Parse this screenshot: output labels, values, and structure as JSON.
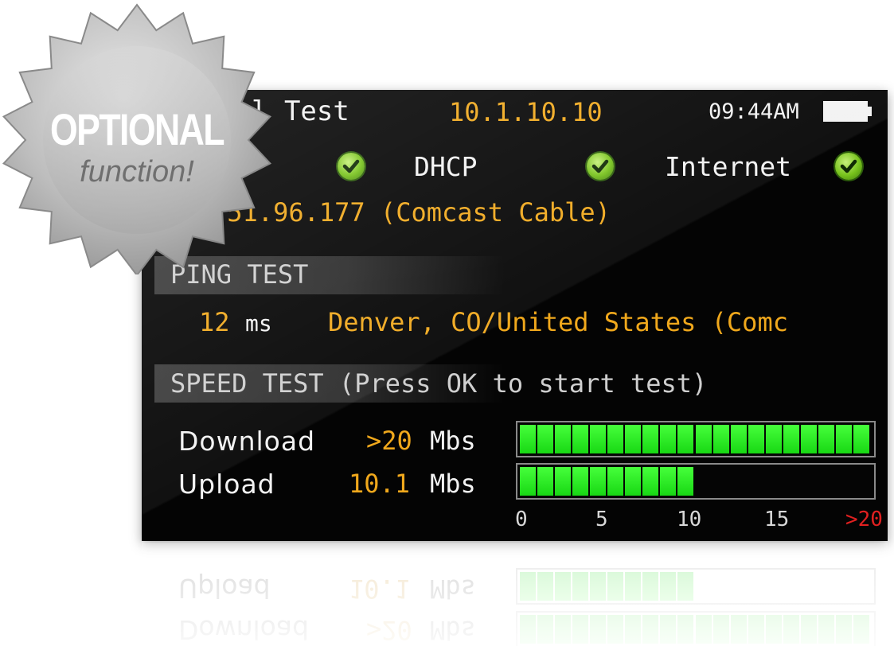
{
  "header": {
    "title": "l Test",
    "ip": "10.1.10.10",
    "time": "09:44AM",
    "battery_icon": "battery-full-icon"
  },
  "status": {
    "dhcp_label": "DHCP",
    "internet_label": "Internet",
    "check_icon": "check-circle-icon"
  },
  "public_ip_line": ".51.96.177 (Comcast Cable)",
  "ping": {
    "section_title": "PING TEST",
    "value": "12",
    "unit": "ms",
    "server": "Denver, CO/United States (Comc"
  },
  "speed": {
    "section_title": "SPEED TEST (Press OK to start test)",
    "download": {
      "label": "Download",
      "value": ">20",
      "unit": "Mbs",
      "level_fraction": 1.0
    },
    "upload": {
      "label": "Upload",
      "value": "10.1",
      "unit": "Mbs",
      "level_fraction": 0.5
    },
    "scale": [
      "0",
      "5",
      "10",
      "15",
      ">20"
    ]
  },
  "badge": {
    "line1": "OPTIONAL",
    "line2": "function!"
  },
  "colors": {
    "amber": "#f0a81c",
    "bar_green": "#2ef020",
    "scale_max_red": "#e02020",
    "check_green": "#77c21c"
  }
}
